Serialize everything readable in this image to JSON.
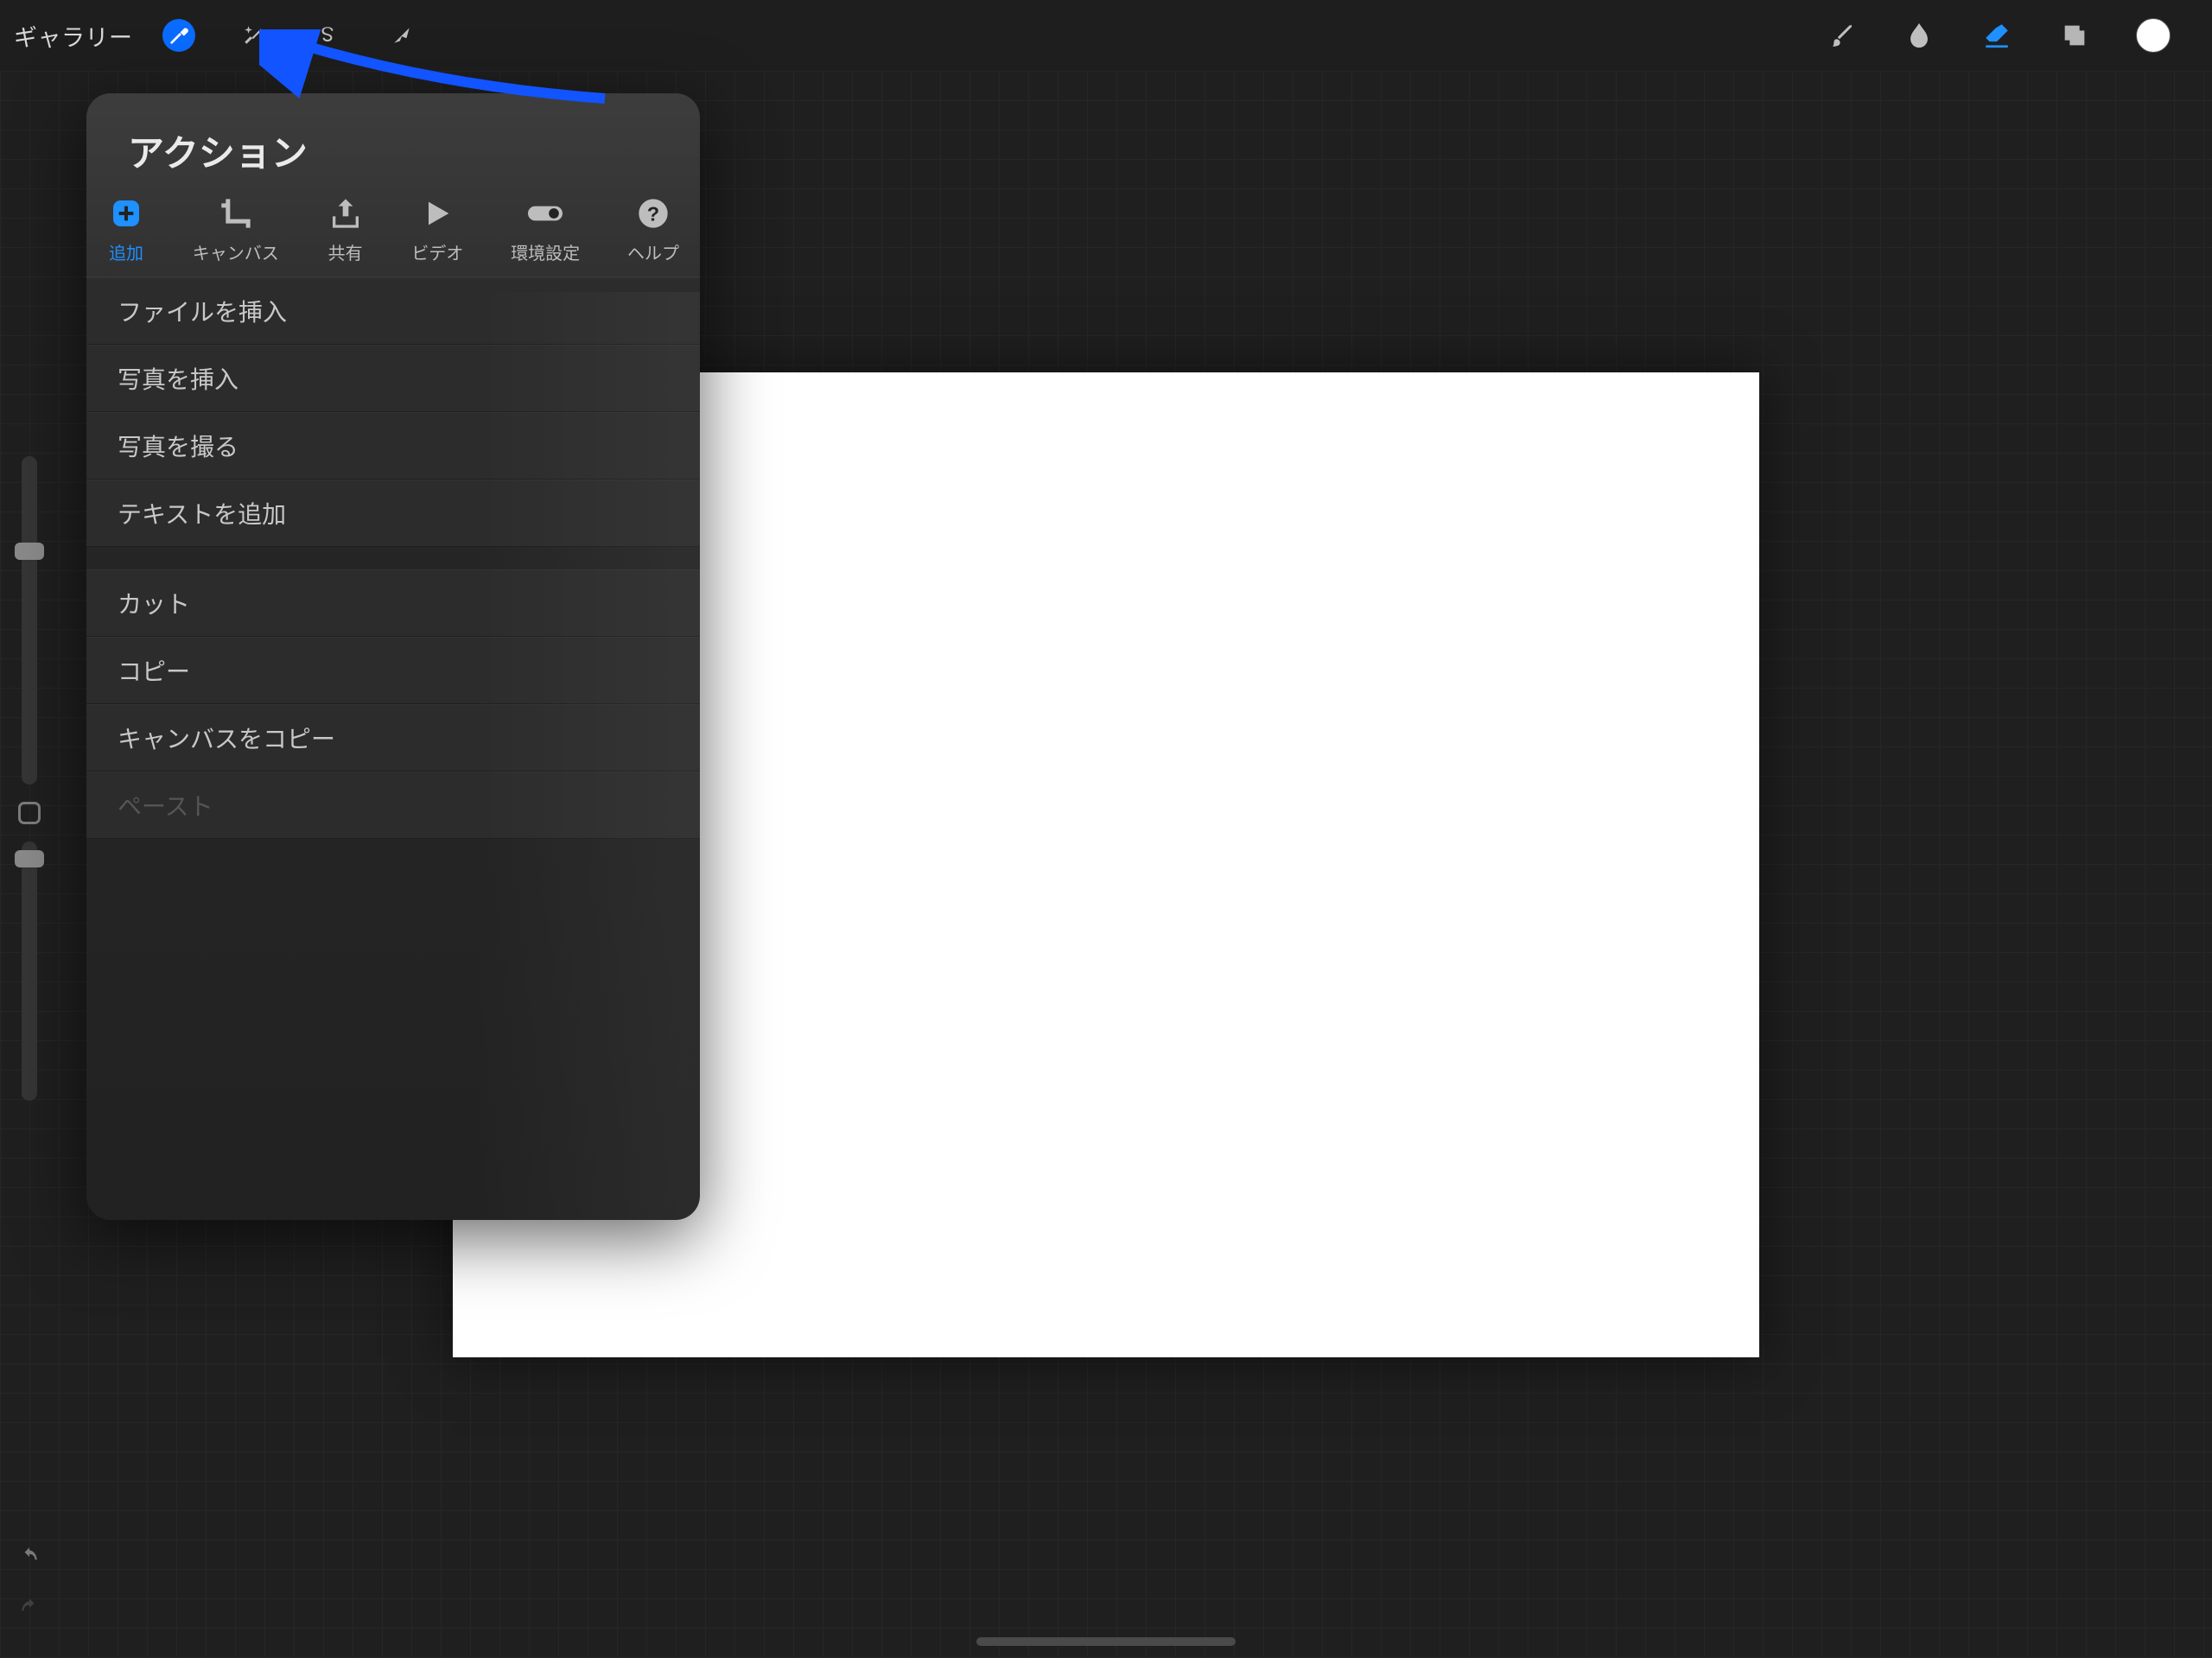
{
  "topbar": {
    "gallery_label": "ギャラリー"
  },
  "popover": {
    "title": "アクション",
    "tabs": [
      {
        "id": "add",
        "label": "追加"
      },
      {
        "id": "canvas",
        "label": "キャンバス"
      },
      {
        "id": "share",
        "label": "共有"
      },
      {
        "id": "video",
        "label": "ビデオ"
      },
      {
        "id": "prefs",
        "label": "環境設定"
      },
      {
        "id": "help",
        "label": "ヘルプ"
      }
    ],
    "group1": [
      "ファイルを挿入",
      "写真を挿入",
      "写真を撮る",
      "テキストを追加"
    ],
    "group2": [
      "カット",
      "コピー",
      "キャンバスをコピー"
    ],
    "group2_disabled": "ペースト"
  },
  "colors": {
    "accent": "#0a6bff",
    "accent_light": "#1e90ff",
    "swatch": "#ffffff"
  }
}
